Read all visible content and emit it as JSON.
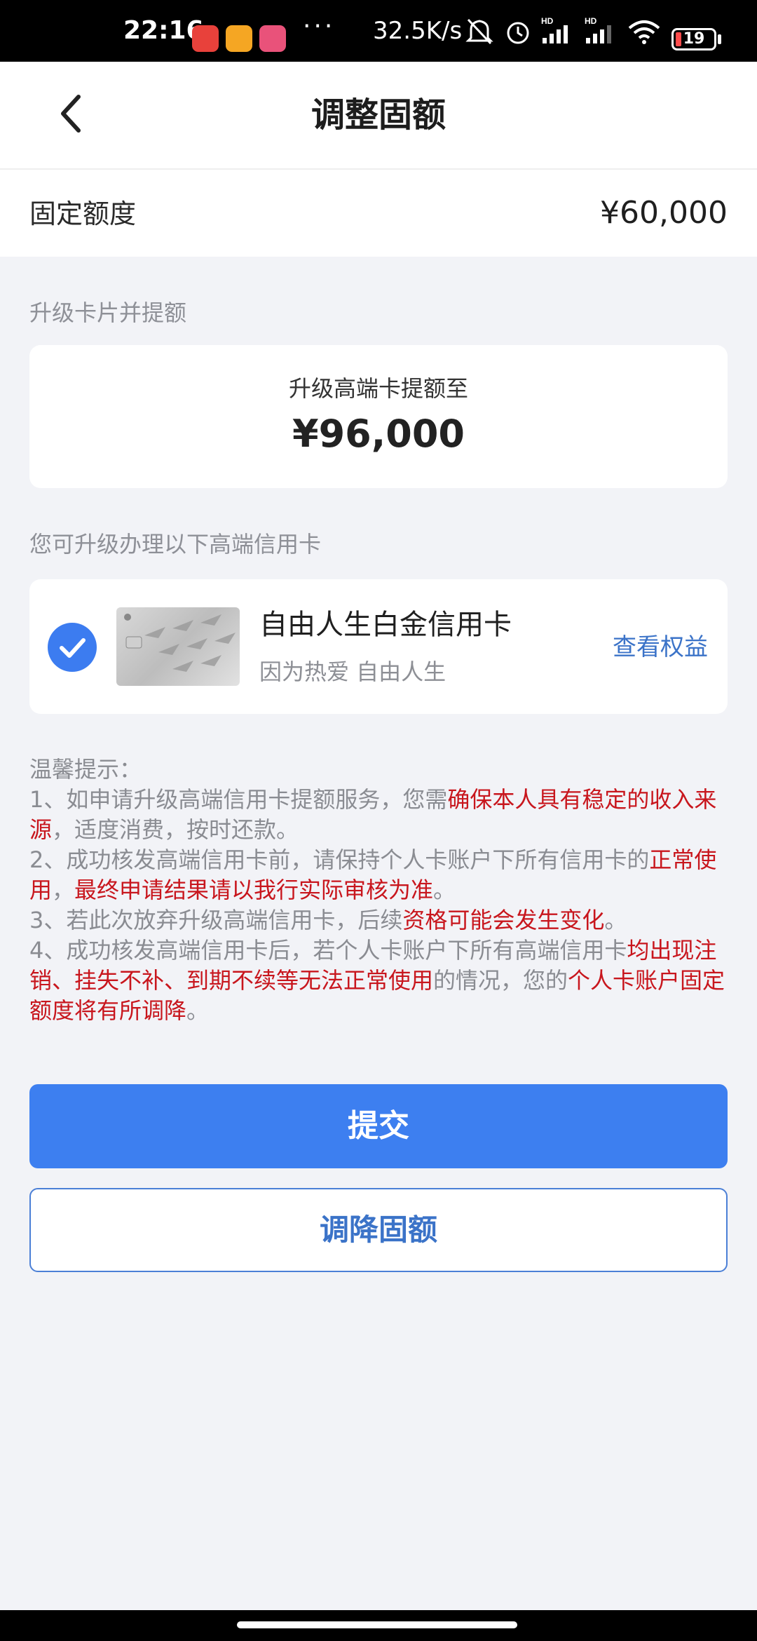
{
  "status_bar": {
    "time": "22:16",
    "net_speed": "32.5K/s",
    "battery": "19",
    "icons": [
      "app-icon-red",
      "app-icon-yellow",
      "app-icon-pink",
      "more-dots",
      "mute-icon",
      "alarm-icon",
      "signal-hd-icon",
      "signal-hd-icon",
      "wifi-icon",
      "battery-icon"
    ],
    "more": "···"
  },
  "header": {
    "title": "调整固额",
    "back_icon": "chevron-left-icon"
  },
  "fixed_limit": {
    "label": "固定额度",
    "value": "¥60,000"
  },
  "upgrade": {
    "section_title": "升级卡片并提额",
    "subtitle": "升级高端卡提额至",
    "amount": "¥96,000"
  },
  "cards": {
    "section_title": "您可升级办理以下高端信用卡",
    "items": [
      {
        "name": "自由人生白金信用卡",
        "slogan": "因为热爱 自由人生",
        "link": "查看权益",
        "selected": true
      }
    ]
  },
  "tips": {
    "title": "温馨提示：",
    "t1_a": "1、如申请升级高端信用卡提额服务，您需",
    "t1_b": "确保本人具有稳定的收入来源",
    "t1_c": "，适度消费，按时还款。",
    "t2_a": "2、成功核发高端信用卡前，请保持个人卡账户下所有信用卡的",
    "t2_b": "正常使用",
    "t2_c": "，",
    "t2_d": "最终申请结果请以我行实际审核为准",
    "t2_e": "。",
    "t3_a": "3、若此次放弃升级高端信用卡，后续",
    "t3_b": "资格可能会发生变化",
    "t3_c": "。",
    "t4_a": "4、成功核发高端信用卡后，若个人卡账户下所有高端信用卡",
    "t4_b": "均出现注销、挂失不补、到期不续等无法正常使用",
    "t4_c": "的情况，您的",
    "t4_d": "个人卡账户固定额度将有所调降",
    "t4_e": "。"
  },
  "buttons": {
    "submit": "提交",
    "reduce": "调降固额"
  },
  "colors": {
    "primary": "#3d7ff0",
    "link": "#3b73c8",
    "warning": "#c8161d",
    "background": "#f2f3f7"
  }
}
